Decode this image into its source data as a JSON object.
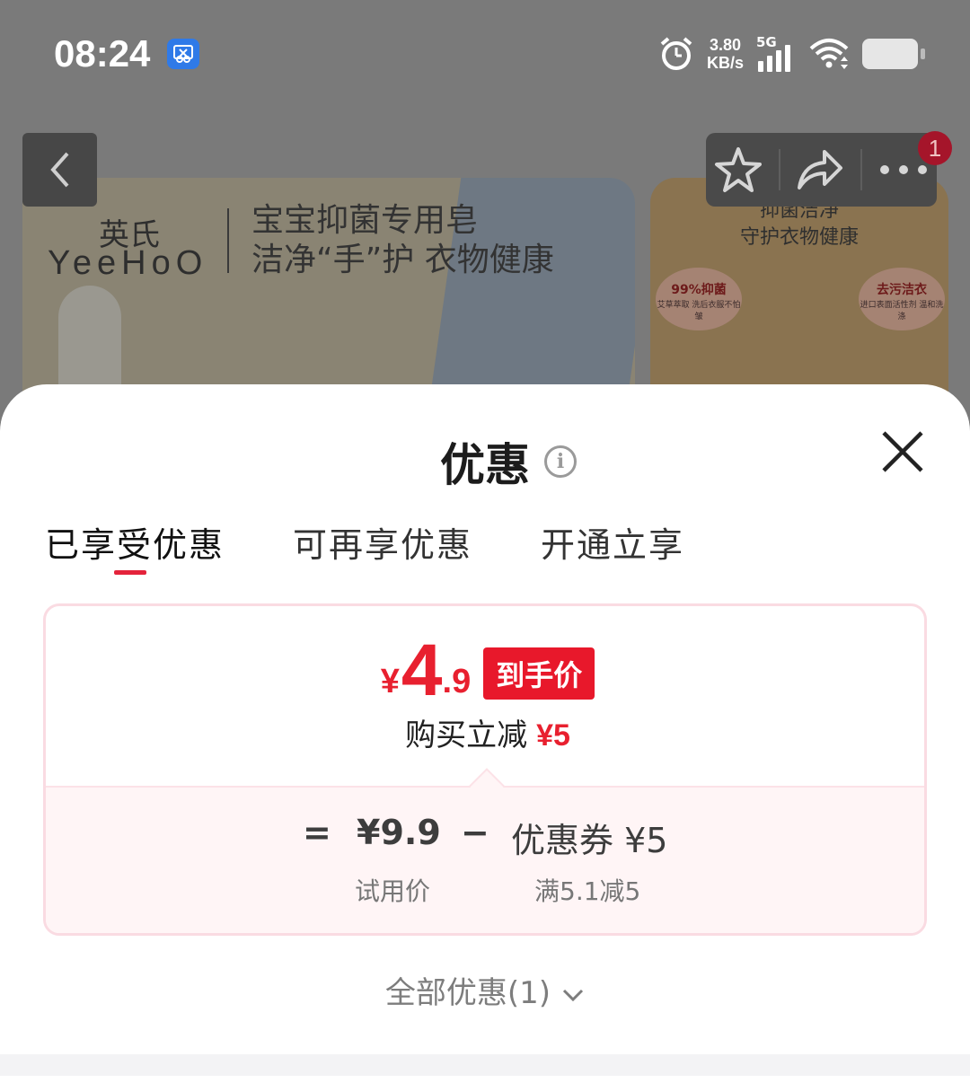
{
  "status_bar": {
    "time": "08:24",
    "net_speed_value": "3.80",
    "net_speed_unit": "KB/s",
    "network_type": "5G"
  },
  "banner": {
    "brand_cn": "英氏",
    "brand_en": "YeeHoO",
    "slogan_line1": "宝宝抑菌专用皂",
    "slogan_line2": "洁净“手”护 衣物健康",
    "side_line1": "抑菌洁净",
    "side_line2": "守护衣物健康",
    "side_badge1_title": "99%抑菌",
    "side_badge1_sub": "艾草萃取 洗后衣服不怕皱",
    "side_badge2_title": "去污洁衣",
    "side_badge2_sub": "进口表面活性剂 温和洗涤"
  },
  "toolbar": {
    "notification_count": "1"
  },
  "sheet": {
    "title": "优惠",
    "info_glyph": "i",
    "tabs": [
      {
        "label": "已享受优惠",
        "active": true
      },
      {
        "label": "可再享优惠",
        "active": false
      },
      {
        "label": "开通立享",
        "active": false
      }
    ],
    "price": {
      "currency": "¥",
      "integer": "4",
      "decimal": ".9",
      "tag": "到手价"
    },
    "instant": {
      "label": "购买立减",
      "amount": "¥5"
    },
    "calc": {
      "equals": "=",
      "base_price": "¥9.9",
      "minus": "−",
      "coupon": "优惠券 ¥5",
      "base_label": "试用价",
      "coupon_rule": "满5.1减5"
    },
    "all_coupons": "全部优惠(1)"
  },
  "colors": {
    "accent_red": "#e8202f",
    "card_border": "#fadbe2",
    "card_bottom_bg": "#fff5f6"
  }
}
